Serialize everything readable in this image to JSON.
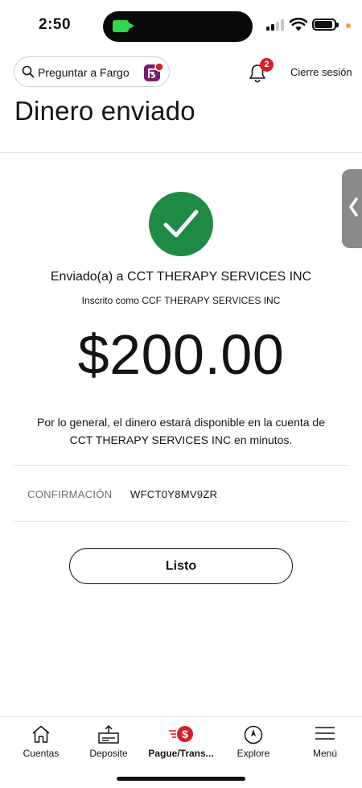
{
  "status_bar": {
    "time": "2:50",
    "colors": {
      "facetime": "#32d74b",
      "privacy_dot": "#f0a030"
    }
  },
  "header": {
    "search_placeholder": "Preguntar a Fargo",
    "notification_count": "2",
    "signout_label": "Cierre sesión",
    "brand_accent": "#d71e28",
    "fargo_color": "#7b1f6a"
  },
  "page": {
    "title": "Dinero enviado"
  },
  "confirmation": {
    "status_icon": "check-icon",
    "status_color": "#1f8a45",
    "sent_to": "Enviado(a) a CCT THERAPY SERVICES INC",
    "enrolled_as": "Inscrito como CCF THERAPY SERVICES INC",
    "amount": "$200.00",
    "availability_line1": "Por lo general, el dinero estará disponible en la cuenta de",
    "availability_line2": "CCT THERAPY SERVICES INC en minutos.",
    "confirmation_label": "CONFIRMACIÓN",
    "confirmation_number": "WFCT0Y8MV9ZR",
    "done_label": "Listo"
  },
  "bottom_nav": [
    {
      "label": "Cuentas",
      "icon": "home-icon",
      "active": false
    },
    {
      "label": "Deposite",
      "icon": "deposit-icon",
      "active": false
    },
    {
      "label": "Pague/Trans...",
      "icon": "pay-transfer-icon",
      "active": true
    },
    {
      "label": "Explore",
      "icon": "compass-icon",
      "active": false
    },
    {
      "label": "Menú",
      "icon": "menu-icon",
      "active": false
    }
  ]
}
